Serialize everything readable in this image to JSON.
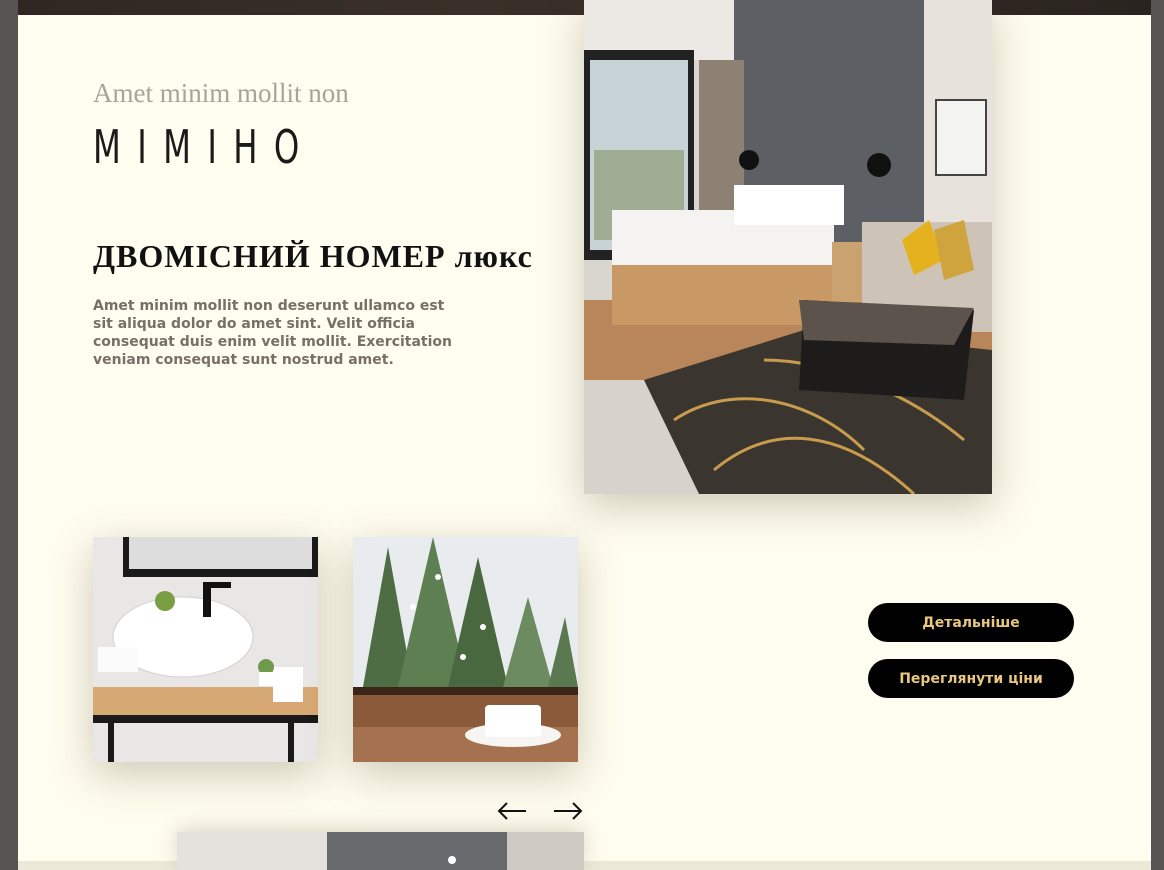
{
  "hero": {
    "subtitle": "Amet minim mollit non",
    "brand": "MIMIHO",
    "room_title": "ДВОМІСНИЙ НОМЕР люкс",
    "description": "Amet minim mollit non deserunt ullamco est sit aliqua dolor do amet sint. Velit officia consequat duis enim velit mollit. Exercitation veniam consequat sunt nostrud amet."
  },
  "gallery": {
    "prev_icon": "arrow-left-icon",
    "next_icon": "arrow-right-icon"
  },
  "actions": {
    "details_label": "Детальніше",
    "prices_label": "Переглянути ціни"
  },
  "colors": {
    "background": "#fffdef",
    "button_bg": "#000000",
    "button_text": "#e9c77d",
    "frame": "#575352"
  }
}
